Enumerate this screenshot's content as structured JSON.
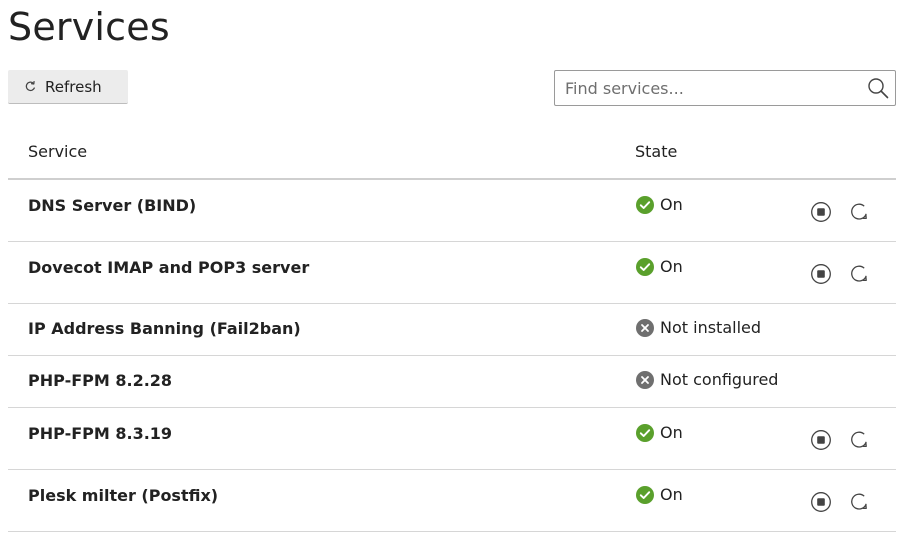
{
  "page": {
    "title": "Services"
  },
  "toolbar": {
    "refresh_label": "Refresh",
    "refresh_icon": "refresh-icon",
    "search_placeholder": "Find services...",
    "search_value": "",
    "search_icon": "magnifier-icon"
  },
  "table": {
    "columns": [
      "Service",
      "State"
    ],
    "rows": [
      {
        "name": "DNS Server (BIND)",
        "state": "On",
        "status": "on",
        "actions": [
          "stop",
          "restart"
        ]
      },
      {
        "name": "Dovecot IMAP and POP3 server",
        "state": "On",
        "status": "on",
        "actions": [
          "stop",
          "restart"
        ]
      },
      {
        "name": "IP Address Banning (Fail2ban)",
        "state": "Not installed",
        "status": "off",
        "actions": []
      },
      {
        "name": "PHP-FPM 8.2.28",
        "state": "Not configured",
        "status": "off",
        "actions": []
      },
      {
        "name": "PHP-FPM 8.3.19",
        "state": "On",
        "status": "on",
        "actions": [
          "stop",
          "restart"
        ]
      },
      {
        "name": "Plesk milter (Postfix)",
        "state": "On",
        "status": "on",
        "actions": [
          "stop",
          "restart"
        ]
      }
    ]
  },
  "colors": {
    "on": "#5aa02c",
    "off": "#6f6f6f",
    "icon_stroke": "#444444"
  }
}
